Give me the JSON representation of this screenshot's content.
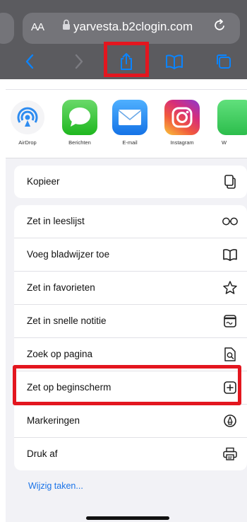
{
  "browser": {
    "text_size_label": "AA",
    "url": "yarvesta.b2clogin.com"
  },
  "share_apps": [
    {
      "label": "AirDrop",
      "icon": "airdrop-icon"
    },
    {
      "label": "Berichten",
      "icon": "messages-icon"
    },
    {
      "label": "E-mail",
      "icon": "mail-icon"
    },
    {
      "label": "Instagram",
      "icon": "instagram-icon"
    },
    {
      "label": "W",
      "icon": "whatsapp-icon"
    }
  ],
  "actions": {
    "copy": {
      "label": "Kopieer",
      "icon": "copy-icon"
    },
    "reading_list": {
      "label": "Zet in leeslijst",
      "icon": "glasses-icon"
    },
    "bookmark": {
      "label": "Voeg bladwijzer toe",
      "icon": "book-icon"
    },
    "favorites": {
      "label": "Zet in favorieten",
      "icon": "star-icon"
    },
    "quick_note": {
      "label": "Zet in snelle notitie",
      "icon": "quick-note-icon"
    },
    "find": {
      "label": "Zoek op pagina",
      "icon": "find-in-page-icon"
    },
    "home_screen": {
      "label": "Zet op beginscherm",
      "icon": "add-square-icon"
    },
    "markup": {
      "label": "Markeringen",
      "icon": "markup-pen-icon"
    },
    "print": {
      "label": "Druk af",
      "icon": "printer-icon"
    }
  },
  "edit_actions_label": "Wijzig taken...",
  "colors": {
    "highlight": "#e3161f",
    "toolbar_blue": "#0a84ff",
    "link": "#1a73e8"
  }
}
